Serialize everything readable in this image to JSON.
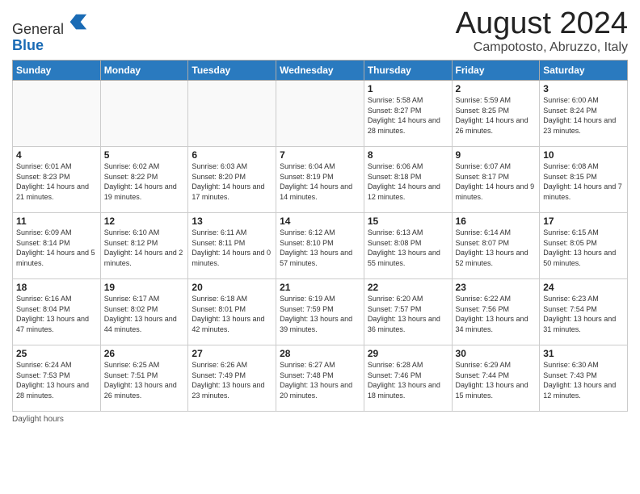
{
  "header": {
    "logo_line1": "General",
    "logo_line2": "Blue",
    "title": "August 2024",
    "location": "Campotosto, Abruzzo, Italy"
  },
  "weekdays": [
    "Sunday",
    "Monday",
    "Tuesday",
    "Wednesday",
    "Thursday",
    "Friday",
    "Saturday"
  ],
  "weeks": [
    [
      {
        "day": "",
        "sunrise": "",
        "sunset": "",
        "daylight": ""
      },
      {
        "day": "",
        "sunrise": "",
        "sunset": "",
        "daylight": ""
      },
      {
        "day": "",
        "sunrise": "",
        "sunset": "",
        "daylight": ""
      },
      {
        "day": "",
        "sunrise": "",
        "sunset": "",
        "daylight": ""
      },
      {
        "day": "1",
        "sunrise": "Sunrise: 5:58 AM",
        "sunset": "Sunset: 8:27 PM",
        "daylight": "Daylight: 14 hours and 28 minutes."
      },
      {
        "day": "2",
        "sunrise": "Sunrise: 5:59 AM",
        "sunset": "Sunset: 8:25 PM",
        "daylight": "Daylight: 14 hours and 26 minutes."
      },
      {
        "day": "3",
        "sunrise": "Sunrise: 6:00 AM",
        "sunset": "Sunset: 8:24 PM",
        "daylight": "Daylight: 14 hours and 23 minutes."
      }
    ],
    [
      {
        "day": "4",
        "sunrise": "Sunrise: 6:01 AM",
        "sunset": "Sunset: 8:23 PM",
        "daylight": "Daylight: 14 hours and 21 minutes."
      },
      {
        "day": "5",
        "sunrise": "Sunrise: 6:02 AM",
        "sunset": "Sunset: 8:22 PM",
        "daylight": "Daylight: 14 hours and 19 minutes."
      },
      {
        "day": "6",
        "sunrise": "Sunrise: 6:03 AM",
        "sunset": "Sunset: 8:20 PM",
        "daylight": "Daylight: 14 hours and 17 minutes."
      },
      {
        "day": "7",
        "sunrise": "Sunrise: 6:04 AM",
        "sunset": "Sunset: 8:19 PM",
        "daylight": "Daylight: 14 hours and 14 minutes."
      },
      {
        "day": "8",
        "sunrise": "Sunrise: 6:06 AM",
        "sunset": "Sunset: 8:18 PM",
        "daylight": "Daylight: 14 hours and 12 minutes."
      },
      {
        "day": "9",
        "sunrise": "Sunrise: 6:07 AM",
        "sunset": "Sunset: 8:17 PM",
        "daylight": "Daylight: 14 hours and 9 minutes."
      },
      {
        "day": "10",
        "sunrise": "Sunrise: 6:08 AM",
        "sunset": "Sunset: 8:15 PM",
        "daylight": "Daylight: 14 hours and 7 minutes."
      }
    ],
    [
      {
        "day": "11",
        "sunrise": "Sunrise: 6:09 AM",
        "sunset": "Sunset: 8:14 PM",
        "daylight": "Daylight: 14 hours and 5 minutes."
      },
      {
        "day": "12",
        "sunrise": "Sunrise: 6:10 AM",
        "sunset": "Sunset: 8:12 PM",
        "daylight": "Daylight: 14 hours and 2 minutes."
      },
      {
        "day": "13",
        "sunrise": "Sunrise: 6:11 AM",
        "sunset": "Sunset: 8:11 PM",
        "daylight": "Daylight: 14 hours and 0 minutes."
      },
      {
        "day": "14",
        "sunrise": "Sunrise: 6:12 AM",
        "sunset": "Sunset: 8:10 PM",
        "daylight": "Daylight: 13 hours and 57 minutes."
      },
      {
        "day": "15",
        "sunrise": "Sunrise: 6:13 AM",
        "sunset": "Sunset: 8:08 PM",
        "daylight": "Daylight: 13 hours and 55 minutes."
      },
      {
        "day": "16",
        "sunrise": "Sunrise: 6:14 AM",
        "sunset": "Sunset: 8:07 PM",
        "daylight": "Daylight: 13 hours and 52 minutes."
      },
      {
        "day": "17",
        "sunrise": "Sunrise: 6:15 AM",
        "sunset": "Sunset: 8:05 PM",
        "daylight": "Daylight: 13 hours and 50 minutes."
      }
    ],
    [
      {
        "day": "18",
        "sunrise": "Sunrise: 6:16 AM",
        "sunset": "Sunset: 8:04 PM",
        "daylight": "Daylight: 13 hours and 47 minutes."
      },
      {
        "day": "19",
        "sunrise": "Sunrise: 6:17 AM",
        "sunset": "Sunset: 8:02 PM",
        "daylight": "Daylight: 13 hours and 44 minutes."
      },
      {
        "day": "20",
        "sunrise": "Sunrise: 6:18 AM",
        "sunset": "Sunset: 8:01 PM",
        "daylight": "Daylight: 13 hours and 42 minutes."
      },
      {
        "day": "21",
        "sunrise": "Sunrise: 6:19 AM",
        "sunset": "Sunset: 7:59 PM",
        "daylight": "Daylight: 13 hours and 39 minutes."
      },
      {
        "day": "22",
        "sunrise": "Sunrise: 6:20 AM",
        "sunset": "Sunset: 7:57 PM",
        "daylight": "Daylight: 13 hours and 36 minutes."
      },
      {
        "day": "23",
        "sunrise": "Sunrise: 6:22 AM",
        "sunset": "Sunset: 7:56 PM",
        "daylight": "Daylight: 13 hours and 34 minutes."
      },
      {
        "day": "24",
        "sunrise": "Sunrise: 6:23 AM",
        "sunset": "Sunset: 7:54 PM",
        "daylight": "Daylight: 13 hours and 31 minutes."
      }
    ],
    [
      {
        "day": "25",
        "sunrise": "Sunrise: 6:24 AM",
        "sunset": "Sunset: 7:53 PM",
        "daylight": "Daylight: 13 hours and 28 minutes."
      },
      {
        "day": "26",
        "sunrise": "Sunrise: 6:25 AM",
        "sunset": "Sunset: 7:51 PM",
        "daylight": "Daylight: 13 hours and 26 minutes."
      },
      {
        "day": "27",
        "sunrise": "Sunrise: 6:26 AM",
        "sunset": "Sunset: 7:49 PM",
        "daylight": "Daylight: 13 hours and 23 minutes."
      },
      {
        "day": "28",
        "sunrise": "Sunrise: 6:27 AM",
        "sunset": "Sunset: 7:48 PM",
        "daylight": "Daylight: 13 hours and 20 minutes."
      },
      {
        "day": "29",
        "sunrise": "Sunrise: 6:28 AM",
        "sunset": "Sunset: 7:46 PM",
        "daylight": "Daylight: 13 hours and 18 minutes."
      },
      {
        "day": "30",
        "sunrise": "Sunrise: 6:29 AM",
        "sunset": "Sunset: 7:44 PM",
        "daylight": "Daylight: 13 hours and 15 minutes."
      },
      {
        "day": "31",
        "sunrise": "Sunrise: 6:30 AM",
        "sunset": "Sunset: 7:43 PM",
        "daylight": "Daylight: 13 hours and 12 minutes."
      }
    ]
  ],
  "footer": {
    "note": "Daylight hours"
  }
}
